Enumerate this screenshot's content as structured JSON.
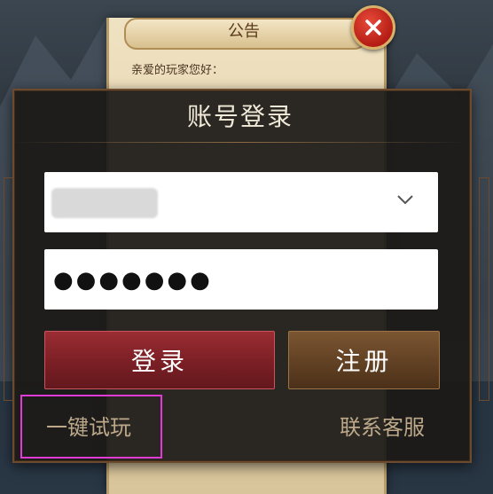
{
  "notice": {
    "title": "公告",
    "greeting": "亲爱的玩家您好："
  },
  "dialog": {
    "title": "账号登录",
    "username": {
      "value": ""
    },
    "password": {
      "masked_value": "●●●●●●●"
    },
    "login_label": "登录",
    "register_label": "注册",
    "trial_label": "一键试玩",
    "support_label": "联系客服"
  },
  "colors": {
    "login_button": "#7a1f25",
    "register_button": "#5f3f22",
    "highlight_box": "#e03ad7",
    "link_text": "#bda98a"
  }
}
